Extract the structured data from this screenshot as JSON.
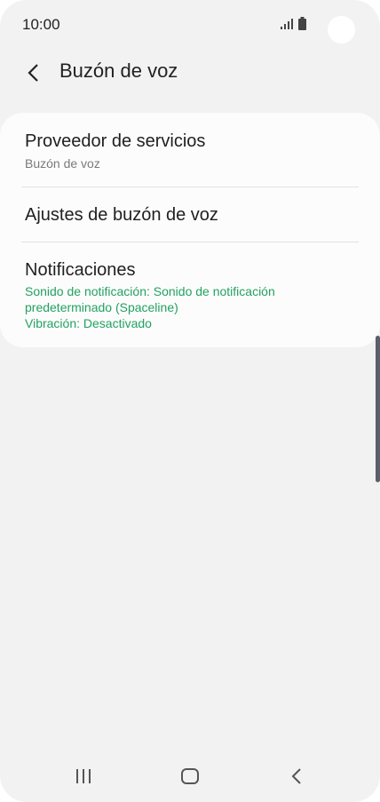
{
  "status_bar": {
    "time": "10:00"
  },
  "header": {
    "title": "Buzón de voz"
  },
  "settings": [
    {
      "title": "Proveedor de servicios",
      "subtitle": "Buzón de voz"
    },
    {
      "title": "Ajustes de buzón de voz"
    },
    {
      "title": "Notificaciones",
      "detail_line1": "Sonido de notificación: Sonido de notificación",
      "detail_line2": "predeterminado (Spaceline)",
      "detail_line3": "Vibración: Desactivado"
    }
  ],
  "colors": {
    "accent_green": "#23a161",
    "background": "#f2f2f2",
    "card": "#fcfcfc"
  },
  "icons": [
    "signal-icon",
    "battery-icon",
    "back-arrow-icon",
    "recent-apps-icon",
    "home-icon",
    "back-icon"
  ]
}
